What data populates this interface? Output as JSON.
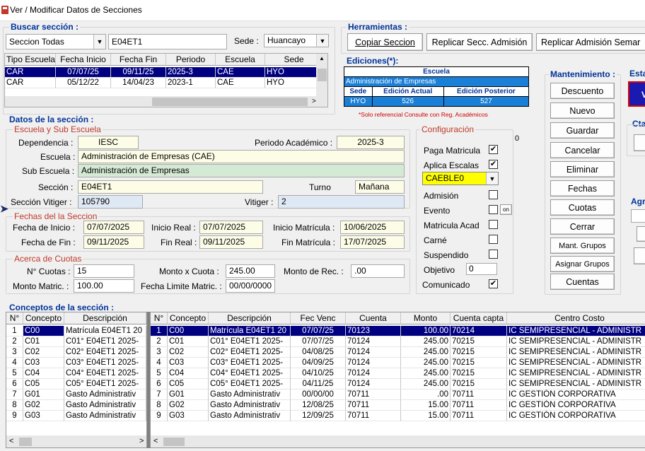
{
  "window": {
    "title": "Ver / Modificar Datos de Secciones"
  },
  "buscar": {
    "label": "Buscar sección :",
    "filter": "Seccion Todas",
    "search": "E04ET1",
    "sede_label": "Sede :",
    "sede": "Huancayo",
    "columns": [
      "Tipo Escuela",
      "Fecha Inicio",
      "Fecha Fin",
      "Periodo",
      "Escuela",
      "Sede"
    ],
    "rows": [
      [
        "CAR",
        "07/07/25",
        "09/11/25",
        "2025-3",
        "CAE",
        "HYO"
      ],
      [
        "CAR",
        "05/12/22",
        "14/04/23",
        "2023-1",
        "CAE",
        "HYO"
      ]
    ]
  },
  "herramientas": {
    "label": "Herramientas :",
    "copiar": "Copiar Seccion",
    "replicar": "Replicar Secc. Admisión",
    "replicar_sem": "Replicar Admisión Semar"
  },
  "ediciones": {
    "label": "Ediciones(*):",
    "escuela_h": "Escuela",
    "escuela": "Administración de Empresas",
    "h_sede": "Sede",
    "h_actual": "Edición Actual",
    "h_post": "Edición Posterior",
    "sede": "HYO",
    "actual": "526",
    "posterior": "527",
    "note": "*Solo referencial Consulte con Reg. Académicos"
  },
  "mant": {
    "label": "Mantenimiento :",
    "buttons": [
      "Descuento",
      "Nuevo",
      "Guardar",
      "Cancelar",
      "Eliminar",
      "Fechas",
      "Cuotas",
      "Cerrar",
      "Mant. Grupos",
      "Asignar Grupos",
      "Cuentas"
    ]
  },
  "right": {
    "esta": "Esta",
    "cta": "Cta",
    "agr": "Agr",
    "v": "V"
  },
  "datos": {
    "label": "Datos de la sección :",
    "sub_label": "Escuela y Sub Escuela",
    "dependencia_l": "Dependencia :",
    "dependencia": "IESC",
    "periodo_l": "Periodo Académico :",
    "periodo": "2025-3",
    "escuela_l": "Escuela :",
    "escuela": "Administración de Empresas (CAE)",
    "subescuela_l": "Sub Escuela :",
    "subescuela": "Administración de Empresas",
    "seccion_l": "Sección :",
    "seccion": "E04ET1",
    "turno_l": "Turno",
    "turno": "Mañana",
    "vitiger_l": "Sección Vitiger :",
    "vitiger_s": "105790",
    "vitiger2_l": "Vitiger :",
    "vitiger2": "2"
  },
  "fechas": {
    "label": "Fechas del la Seccion",
    "inicio_l": "Fecha de Inicio :",
    "inicio": "07/07/2025",
    "inireal_l": "Inicio Real :",
    "inireal": "07/07/2025",
    "inimat_l": "Inicio Matrícula :",
    "inimat": "10/06/2025",
    "fin_l": "Fecha de Fin :",
    "fin": "09/11/2025",
    "finreal_l": "Fin Real :",
    "finreal": "09/11/2025",
    "finmat_l": "Fin Matrícula :",
    "finmat": "17/07/2025"
  },
  "cuotas": {
    "label": "Acerca de Cuotas",
    "num_l": "N° Cuotas :",
    "num": "15",
    "monto_l": "Monto x Cuota :",
    "monto": "245.00",
    "rec_l": "Monto de Rec. :",
    "rec": ".00",
    "matric_l": "Monto Matric. :",
    "matric": "100.00",
    "limite_l": "Fecha Limite Matric. :",
    "limite": "00/00/0000"
  },
  "config": {
    "label": "Configuración",
    "paga": "Paga Matricula",
    "aplica": "Aplica Escalas",
    "escala": "CAEBLE0",
    "admision": "Admisión",
    "evento": "Evento",
    "on": "on",
    "matacad": "Matricula Acad",
    "carne": "Carné",
    "susp": "Suspendido",
    "objetivo": "Objetivo",
    "objetivo_v": "0",
    "comunicado": "Comunicado",
    "zero": "0",
    "checks": {
      "paga": true,
      "aplica": true,
      "admision": false,
      "evento": false,
      "matacad": false,
      "carne": false,
      "susp": false,
      "comunicado": true
    }
  },
  "conceptos": {
    "label": "Conceptos de la sección :",
    "left_cols": [
      "N°",
      "Concepto",
      "Descripción"
    ],
    "right_cols": [
      "N°",
      "Concepto",
      "Descripción",
      "Fec Venc",
      "Cuenta",
      "Monto",
      "Cuenta capta",
      "Centro Costo"
    ],
    "left_rows": [
      [
        "1",
        "C00",
        "Matrícula E04ET1 20"
      ],
      [
        "2",
        "C01",
        "C01° E04ET1 2025-"
      ],
      [
        "3",
        "C02",
        "C02° E04ET1 2025-"
      ],
      [
        "4",
        "C03",
        "C03° E04ET1 2025-"
      ],
      [
        "5",
        "C04",
        "C04° E04ET1 2025-"
      ],
      [
        "6",
        "C05",
        "C05° E04ET1 2025-"
      ],
      [
        "7",
        "G01",
        "Gasto Administrativ"
      ],
      [
        "8",
        "G02",
        "Gasto Administrativ"
      ],
      [
        "9",
        "G03",
        "Gasto Administrativ"
      ]
    ],
    "right_rows": [
      [
        "1",
        "C00",
        "Matrícula E04ET1 20",
        "07/07/25",
        "70123",
        "100.00",
        "70214",
        "IC SEMIPRESENCIAL - ADMINISTR"
      ],
      [
        "2",
        "C01",
        "C01° E04ET1 2025-",
        "07/07/25",
        "70124",
        "245.00",
        "70215",
        "IC SEMIPRESENCIAL - ADMINISTR"
      ],
      [
        "3",
        "C02",
        "C02° E04ET1 2025-",
        "04/08/25",
        "70124",
        "245.00",
        "70215",
        "IC SEMIPRESENCIAL - ADMINISTR"
      ],
      [
        "4",
        "C03",
        "C03° E04ET1 2025-",
        "04/09/25",
        "70124",
        "245.00",
        "70215",
        "IC SEMIPRESENCIAL - ADMINISTR"
      ],
      [
        "5",
        "C04",
        "C04° E04ET1 2025-",
        "04/10/25",
        "70124",
        "245.00",
        "70215",
        "IC SEMIPRESENCIAL - ADMINISTR"
      ],
      [
        "6",
        "C05",
        "C05° E04ET1 2025-",
        "04/11/25",
        "70124",
        "245.00",
        "70215",
        "IC SEMIPRESENCIAL - ADMINISTR"
      ],
      [
        "7",
        "G01",
        "Gasto Administrativ",
        "00/00/00",
        "70711",
        ".00",
        "70711",
        "IC GESTIÓN CORPORATIVA"
      ],
      [
        "8",
        "G02",
        "Gasto Administrativ",
        "12/08/25",
        "70711",
        "15.00",
        "70711",
        "IC GESTIÓN CORPORATIVA"
      ],
      [
        "9",
        "G03",
        "Gasto Administrativ",
        "12/09/25",
        "70711",
        "15.00",
        "70711",
        "IC GESTIÓN CORPORATIVA"
      ]
    ]
  },
  "colors": {
    "selection": "#000080",
    "label_blue": "#003399",
    "label_red": "#c0392b"
  }
}
